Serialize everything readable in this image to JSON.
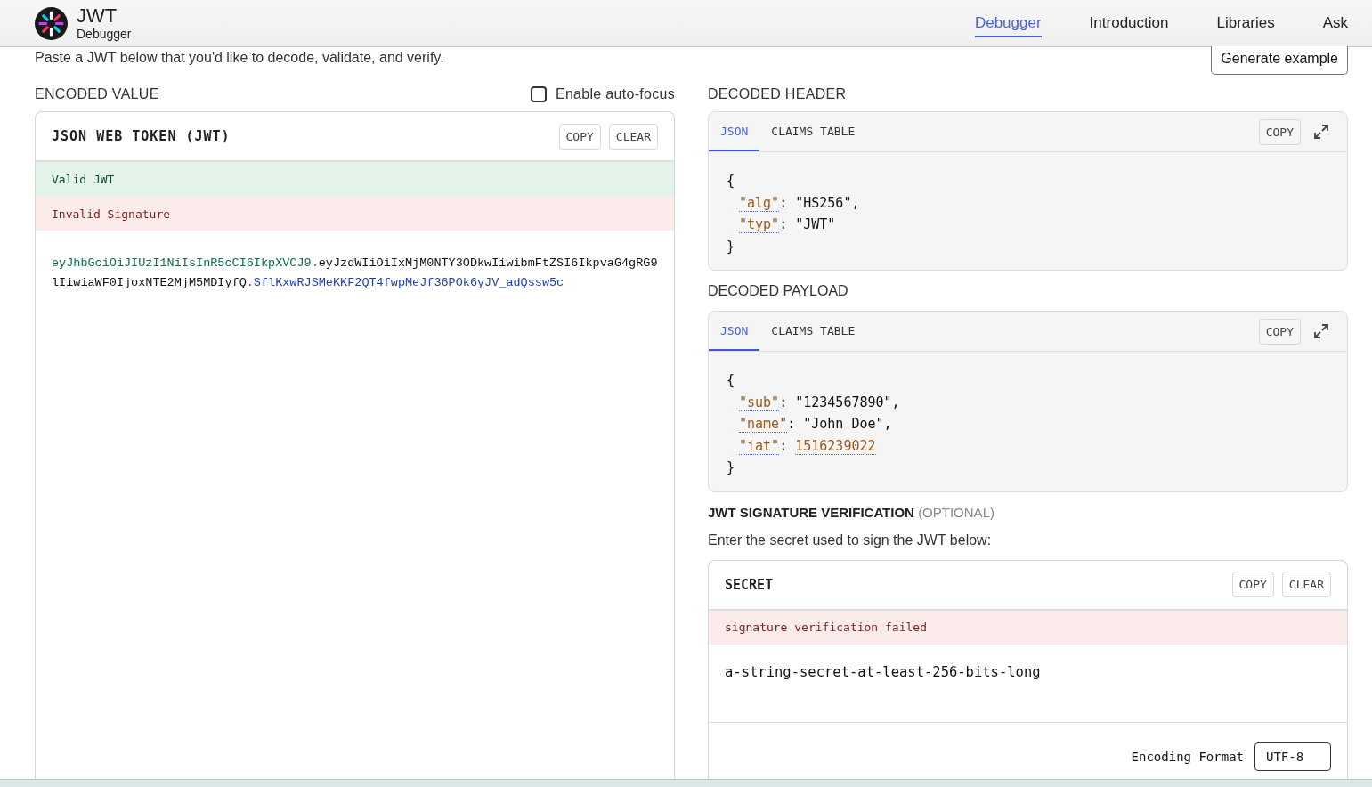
{
  "brand": {
    "title": "JWT",
    "subtitle": "Debugger"
  },
  "nav": [
    {
      "label": "Debugger",
      "selected": true
    },
    {
      "label": "Introduction",
      "selected": false
    },
    {
      "label": "Libraries",
      "selected": false
    },
    {
      "label": "Ask",
      "selected": false
    }
  ],
  "intro": "Paste a JWT below that you'd like to decode, validate, and verify.",
  "generate_button": "Generate example",
  "encoded": {
    "title": "ENCODED VALUE",
    "autofocus": {
      "label": "Enable auto-focus",
      "checked": false
    },
    "card_title": "JSON WEB TOKEN (JWT)",
    "buttons": [
      "COPY",
      "CLEAR"
    ],
    "statuses": [
      {
        "kind": "valid",
        "text": "Valid JWT"
      },
      {
        "kind": "invalid",
        "text": "Invalid Signature"
      }
    ],
    "token": [
      {
        "kind": "header",
        "text": "eyJhbGciOiJIUzI1NiIsInR5cCI6IkpXVCJ9"
      },
      {
        "kind": "dot",
        "text": "."
      },
      {
        "kind": "payload",
        "text": "eyJzdWIiOiIxMjM0NTY3ODkwIiwibmFtZSI6IkpvaG4gRG9lIiwiaWF0IjoxNTE2MjM5MDIyfQ"
      },
      {
        "kind": "dot",
        "text": "."
      },
      {
        "kind": "signature",
        "text": "SflKxwRJSMeKKF2QT4fwpMeJf36POk6yJV_adQssw5c"
      }
    ]
  },
  "decoded": [
    {
      "title": "DECODED HEADER",
      "tabs": [
        {
          "label": "JSON",
          "selected": true
        },
        {
          "label": "CLAIMS TABLE",
          "selected": false
        }
      ],
      "copy": "COPY",
      "open": "{",
      "close": "}",
      "lines": [
        {
          "key": "\"alg\"",
          "colon": ":",
          "value": "\"HS256\"",
          "comma": ",",
          "kind": "string"
        },
        {
          "key": "\"typ\"",
          "colon": ":",
          "value": "\"JWT\"",
          "kind": "string"
        }
      ]
    },
    {
      "title": "DECODED PAYLOAD",
      "tabs": [
        {
          "label": "JSON",
          "selected": true
        },
        {
          "label": "CLAIMS TABLE",
          "selected": false
        }
      ],
      "copy": "COPY",
      "open": "{",
      "close": "}",
      "lines": [
        {
          "key": "\"sub\"",
          "colon": ":",
          "value": "\"1234567890\"",
          "comma": ",",
          "kind": "string"
        },
        {
          "key": "\"name\"",
          "colon": ":",
          "value": "\"John Doe\"",
          "comma": ",",
          "kind": "string"
        },
        {
          "key": "\"iat\"",
          "colon": ":",
          "value": "1516239022",
          "kind": "number"
        }
      ]
    }
  ],
  "signature": {
    "title": "JWT SIGNATURE VERIFICATION",
    "title_note": "(OPTIONAL)",
    "description": "Enter the secret used to sign the JWT below:",
    "card_title": "SECRET",
    "buttons": [
      "COPY",
      "CLEAR"
    ],
    "status": {
      "kind": "invalid",
      "text": "signature verification failed"
    },
    "secret": "a-string-secret-at-least-256-bits-long",
    "encoding_label": "Encoding Format",
    "encoding_value": "UTF-8"
  }
}
